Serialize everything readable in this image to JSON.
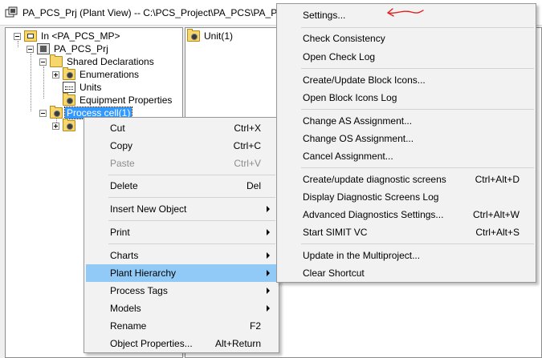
{
  "window": {
    "title": "PA_PCS_Prj (Plant View) -- C:\\PCS_Project\\PA_PCS\\PA_P_Pr"
  },
  "tree": {
    "items": [
      {
        "label": "In <PA_PCS_MP>",
        "icon": "multiproject-icon"
      },
      {
        "label": "PA_PCS_Prj",
        "icon": "project-icon"
      },
      {
        "label": "Shared Declarations",
        "icon": "folder-icon"
      },
      {
        "label": "Enumerations",
        "icon": "folder-gear-icon"
      },
      {
        "label": "Units",
        "icon": "units-icon"
      },
      {
        "label": "Equipment Properties",
        "icon": "folder-gear-icon"
      },
      {
        "label": "Process cell(1)",
        "icon": "folder-gear-icon"
      },
      {
        "label": "",
        "icon": "folder-gear-icon"
      }
    ]
  },
  "content": {
    "items": [
      {
        "label": "Unit(1)",
        "icon": "folder-gear-icon"
      }
    ]
  },
  "context_menu": {
    "items": [
      {
        "label": "Cut",
        "shortcut": "Ctrl+X"
      },
      {
        "label": "Copy",
        "shortcut": "Ctrl+C"
      },
      {
        "label": "Paste",
        "shortcut": "Ctrl+V",
        "disabled": true
      },
      {
        "label": "Delete",
        "shortcut": "Del"
      },
      {
        "label": "Insert New Object",
        "submenu": true
      },
      {
        "label": "Print",
        "submenu": true
      },
      {
        "label": "Charts",
        "submenu": true
      },
      {
        "label": "Plant Hierarchy",
        "submenu": true,
        "highlighted": true
      },
      {
        "label": "Process Tags",
        "submenu": true
      },
      {
        "label": "Models",
        "submenu": true
      },
      {
        "label": "Rename",
        "shortcut": "F2"
      },
      {
        "label": "Object Properties...",
        "shortcut": "Alt+Return"
      }
    ]
  },
  "submenu": {
    "items": [
      {
        "label": "Settings..."
      },
      {
        "label": "Check Consistency"
      },
      {
        "label": "Open Check Log"
      },
      {
        "label": "Create/Update Block Icons..."
      },
      {
        "label": "Open Block Icons Log"
      },
      {
        "label": "Change AS Assignment..."
      },
      {
        "label": "Change OS Assignment..."
      },
      {
        "label": "Cancel Assignment..."
      },
      {
        "label": "Create/update diagnostic screens",
        "shortcut": "Ctrl+Alt+D"
      },
      {
        "label": "Display Diagnostic Screens Log"
      },
      {
        "label": "Advanced Diagnostics Settings...",
        "shortcut": "Ctrl+Alt+W"
      },
      {
        "label": "Start SIMIT VC",
        "shortcut": "Ctrl+Alt+S"
      },
      {
        "label": "Update in the Multiproject..."
      },
      {
        "label": "Clear Shortcut"
      }
    ]
  },
  "colors": {
    "highlight": "#91c9f7",
    "selection": "#3399ff",
    "annotation_arrow": "#e02020"
  }
}
